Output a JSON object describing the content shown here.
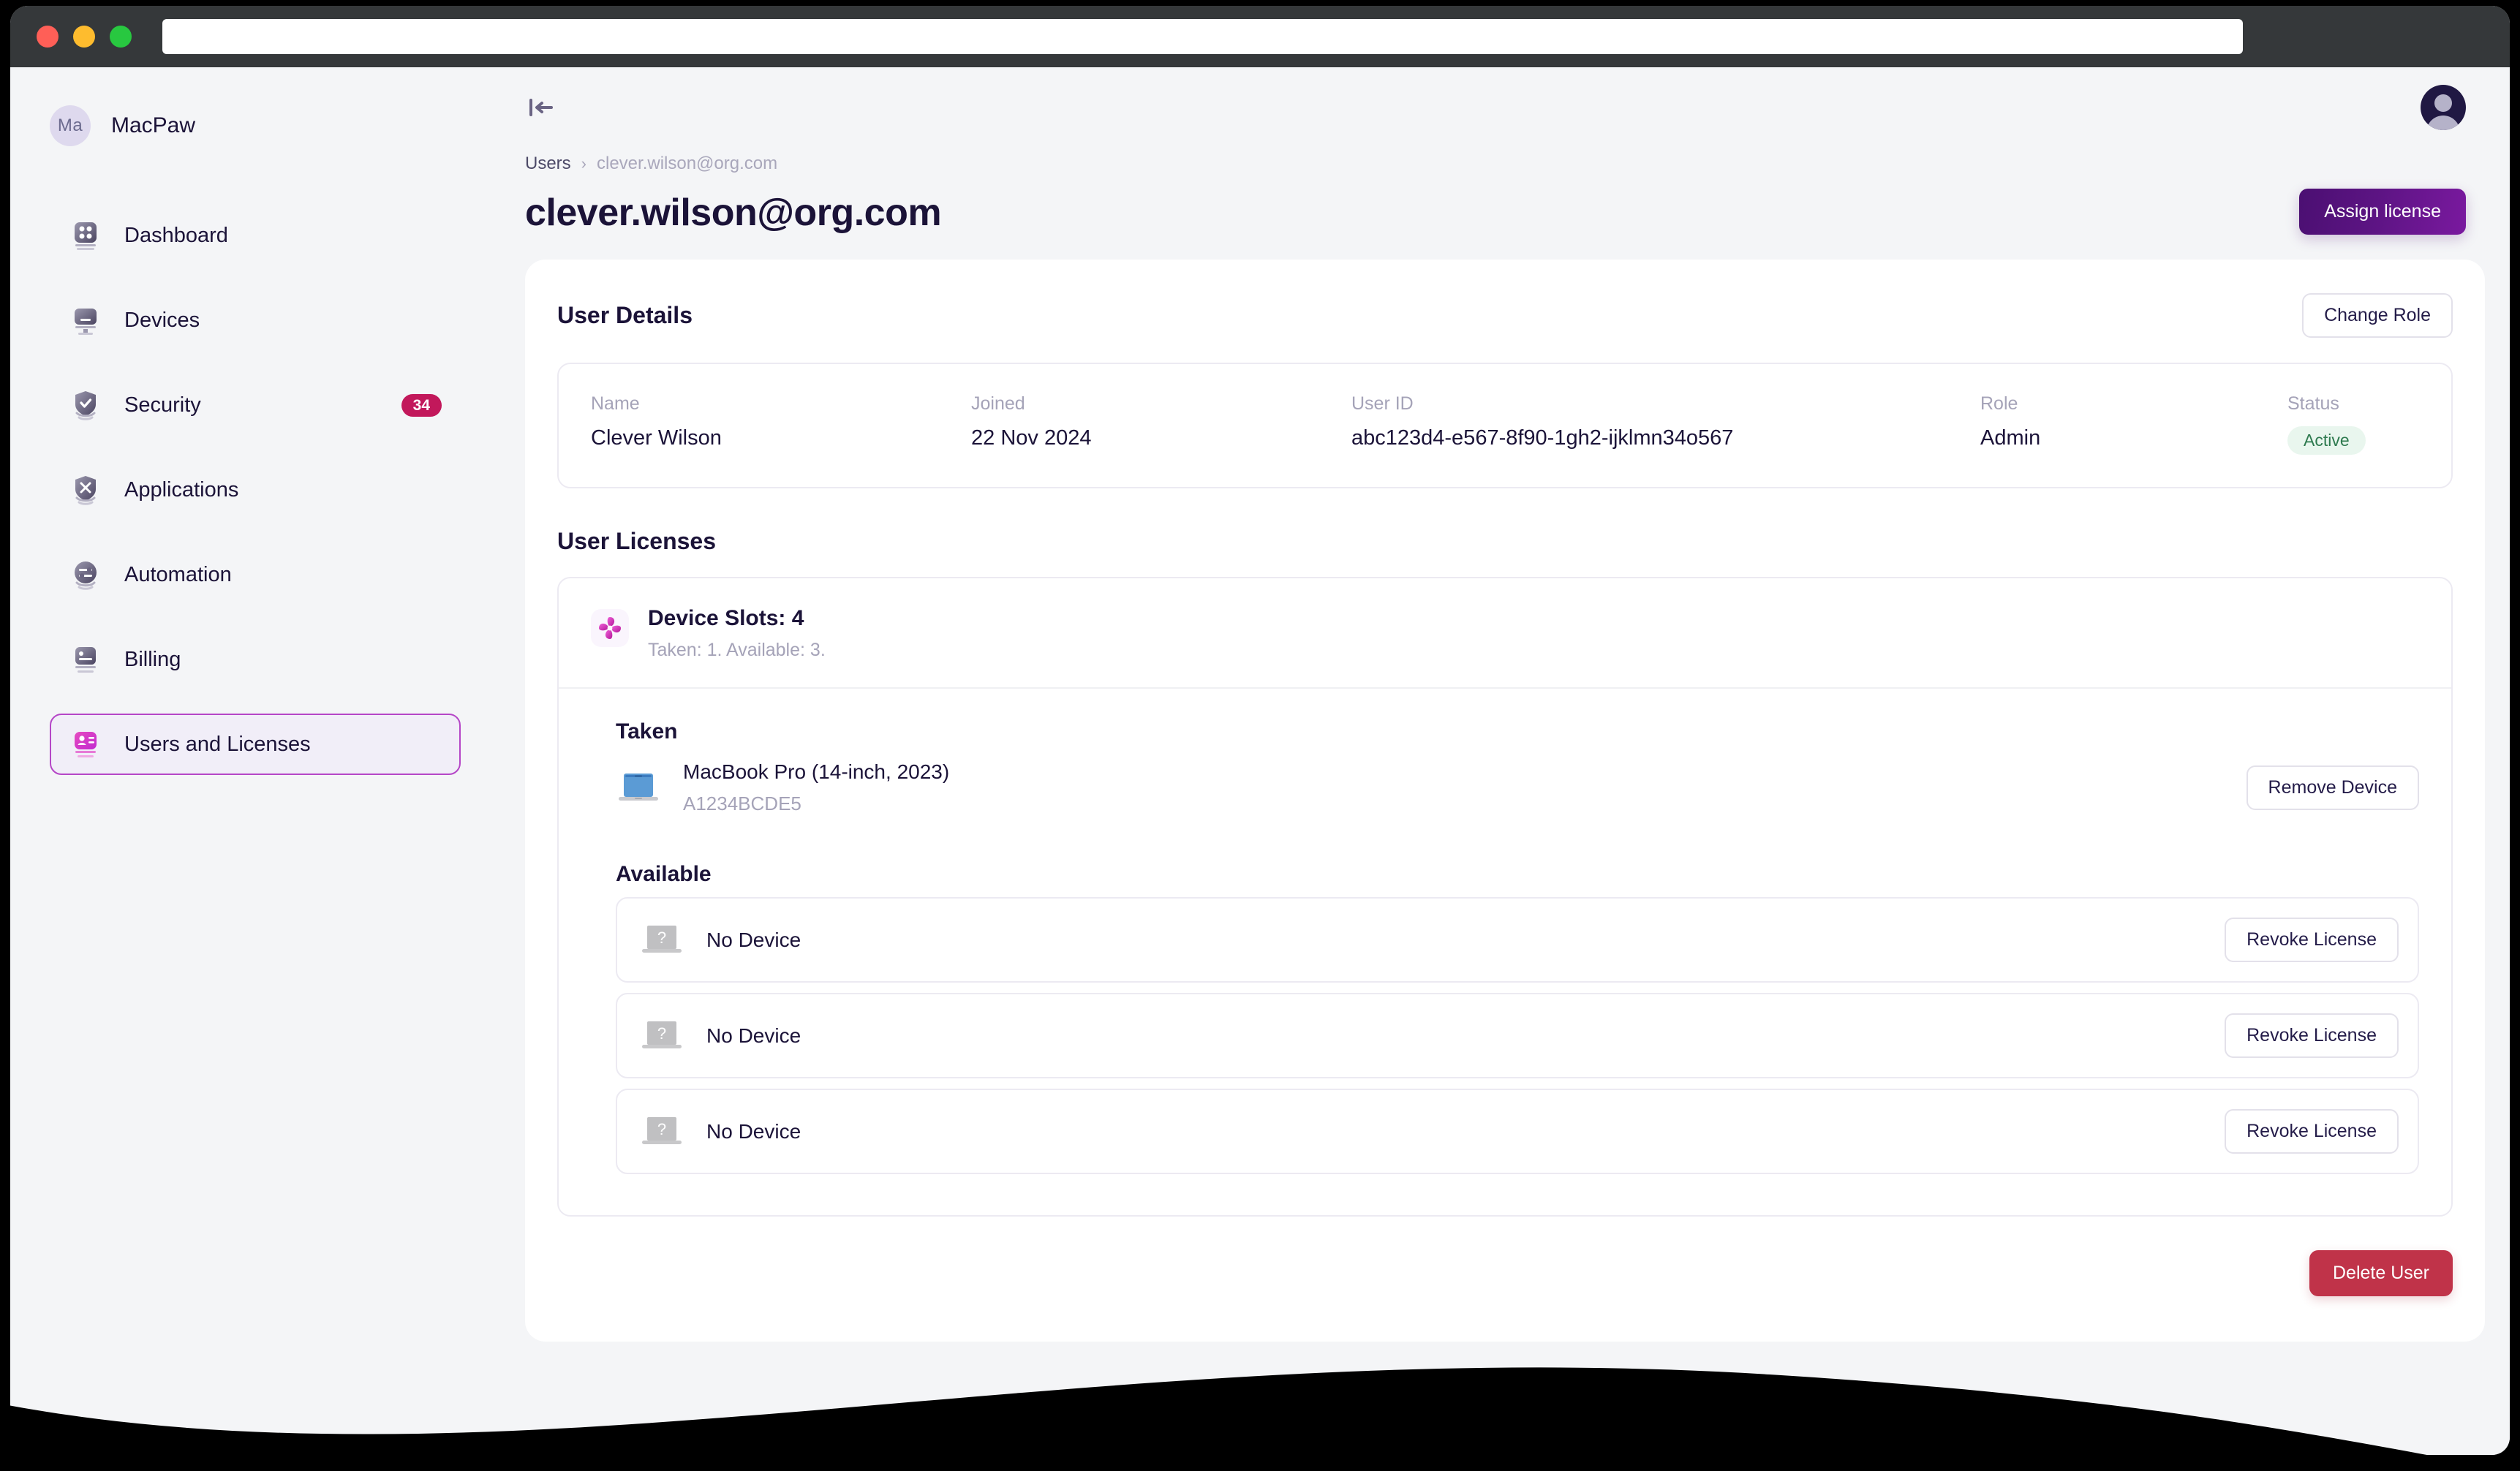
{
  "browser": {
    "url_value": "",
    "url_placeholder": "",
    "traffic_lights": [
      "close-button",
      "minimize-button",
      "maximize-button"
    ]
  },
  "sidebar": {
    "brand": {
      "initials": "Ma",
      "name": "MacPaw"
    },
    "items": [
      {
        "label": "Dashboard",
        "icon": "dashboard-icon",
        "badge": null,
        "active": false
      },
      {
        "label": "Devices",
        "icon": "devices-icon",
        "badge": null,
        "active": false
      },
      {
        "label": "Security",
        "icon": "shield-icon",
        "badge": "34",
        "active": false
      },
      {
        "label": "Applications",
        "icon": "apps-icon",
        "badge": null,
        "active": false
      },
      {
        "label": "Automation",
        "icon": "automation-icon",
        "badge": null,
        "active": false
      },
      {
        "label": "Billing",
        "icon": "billing-icon",
        "badge": null,
        "active": false
      },
      {
        "label": "Users and Licenses",
        "icon": "users-icon",
        "badge": null,
        "active": true
      }
    ]
  },
  "topbar": {
    "collapse_icon": "collapse-sidebar-icon",
    "avatar": "account-avatar"
  },
  "page": {
    "breadcrumb": {
      "root": "Users",
      "separator": "›",
      "current": "clever.wilson@org.com"
    },
    "title": "clever.wilson@org.com",
    "assign_license_label": "Assign license"
  },
  "user_details": {
    "section_title": "User Details",
    "change_role_label": "Change Role",
    "fields": [
      {
        "label": "Name",
        "value": "Clever Wilson"
      },
      {
        "label": "Joined",
        "value": "22 Nov 2024"
      },
      {
        "label": "User ID",
        "value": "abc123d4-e567-8f90-1gh2-ijklmn34o567"
      },
      {
        "label": "Role",
        "value": "Admin"
      },
      {
        "label": "Status",
        "value": "Active"
      }
    ]
  },
  "user_licenses": {
    "section_title": "User Licenses",
    "slot_icon": "cleanmymac-pinwheel-icon",
    "slot_title": "Device Slots: 4",
    "slot_subtitle": "Taken: 1. Available: 3.",
    "taken_title": "Taken",
    "taken_devices": [
      {
        "icon": "macbook-icon",
        "name": "MacBook Pro (14-inch, 2023)",
        "serial": "A1234BCDE5",
        "button": "Remove Device"
      }
    ],
    "available_title": "Available",
    "available_slots": [
      {
        "icon": "no-device-icon",
        "name": "No Device",
        "button": "Revoke License"
      },
      {
        "icon": "no-device-icon",
        "name": "No Device",
        "button": "Revoke License"
      },
      {
        "icon": "no-device-icon",
        "name": "No Device",
        "button": "Revoke License"
      }
    ]
  },
  "footer": {
    "delete_user_label": "Delete User"
  },
  "colors": {
    "accent_purple": "#5c1483",
    "brand_magenta": "#c2185b",
    "danger_red": "#c03349",
    "status_green_text": "#2e7a4f",
    "status_green_bg": "#e9f6ee",
    "page_bg": "#f4f5f7",
    "card_bg": "#ffffff",
    "heading": "#1b1338",
    "muted": "#a5a3b8"
  }
}
